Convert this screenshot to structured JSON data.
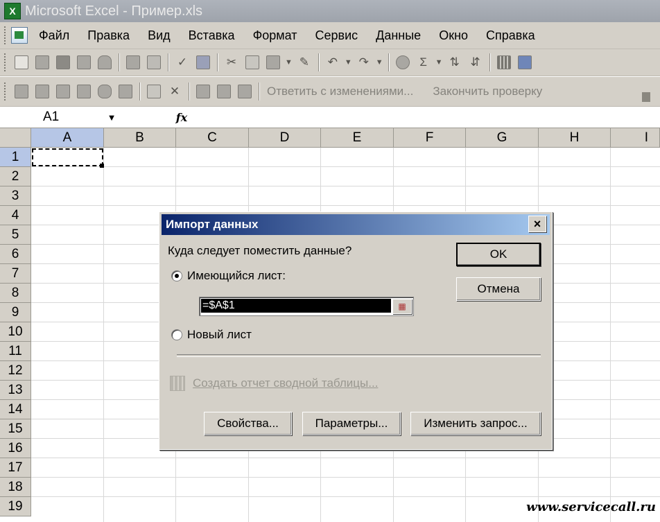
{
  "window": {
    "title": "Microsoft Excel - Пример.xls",
    "app_icon": "X"
  },
  "menu": {
    "items": [
      "Файл",
      "Правка",
      "Вид",
      "Вставка",
      "Формат",
      "Сервис",
      "Данные",
      "Окно",
      "Справка"
    ]
  },
  "toolbar2": {
    "reply_label": "Ответить с изменениями...",
    "end_review_label": "Закончить проверку"
  },
  "formula_bar": {
    "name_box": "A1",
    "fx": "fx"
  },
  "sheet": {
    "columns": [
      "A",
      "B",
      "C",
      "D",
      "E",
      "F",
      "G",
      "H",
      "I"
    ],
    "rows": [
      "1",
      "2",
      "3",
      "4",
      "5",
      "6",
      "7",
      "8",
      "9",
      "10",
      "11",
      "12",
      "13",
      "14",
      "15",
      "16",
      "17",
      "18",
      "19"
    ],
    "active_cell": "A1"
  },
  "dialog": {
    "title": "Импорт данных",
    "close": "×",
    "question": "Куда следует поместить данные?",
    "option_existing": "Имеющийся лист:",
    "reference_value": "=$A$1",
    "option_new": "Новый лист",
    "pivot_link": "Создать отчет сводной таблицы...",
    "ok": "OK",
    "cancel": "Отмена",
    "properties": "Свойства...",
    "parameters": "Параметры...",
    "edit_query": "Изменить запрос..."
  },
  "watermark": "www.servicecall.ru"
}
